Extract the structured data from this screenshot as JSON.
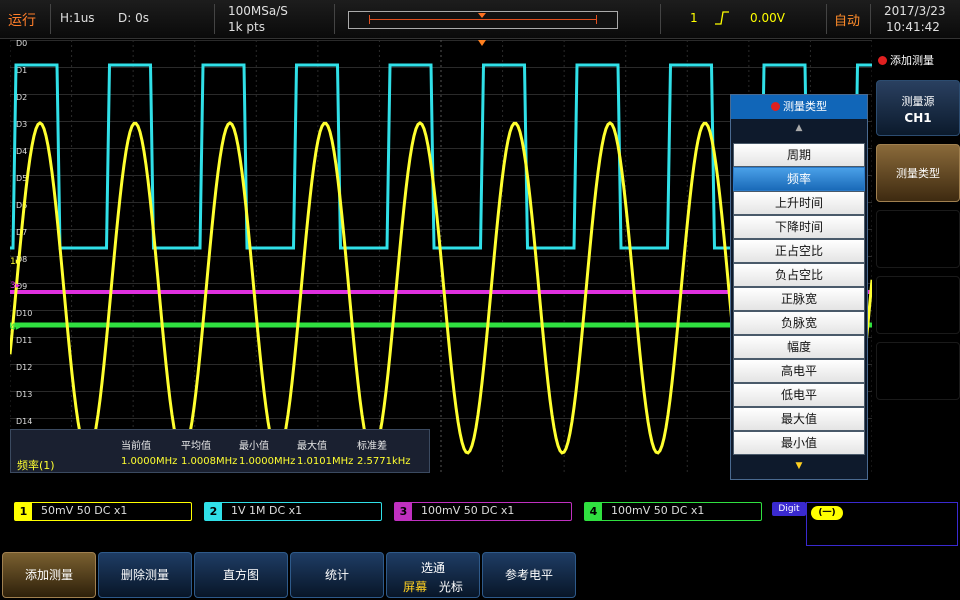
{
  "topbar": {
    "run_status": "运行",
    "horizontal": "H:1us",
    "delay": "D: 0s",
    "sample_rate": "100MSa/S",
    "points": "1k pts",
    "trigger_channel": "1",
    "trigger_level": "0.00V",
    "trigger_mode": "自动",
    "date": "2017/3/23",
    "time": "10:41:42"
  },
  "right_panel": {
    "title": "添加测量",
    "source_label": "测量源",
    "source_value": "CH1",
    "type_label": "测量类型"
  },
  "menu": {
    "title": "测量类型",
    "items": [
      "周期",
      "频率",
      "上升时间",
      "下降时间",
      "正占空比",
      "负占空比",
      "正脉宽",
      "负脉宽",
      "幅度",
      "高电平",
      "低电平",
      "最大值",
      "最小值"
    ],
    "selected_index": 1
  },
  "digital_labels": [
    "D0",
    "D1",
    "D2",
    "D3",
    "D4",
    "D5",
    "D6",
    "D7",
    "D8",
    "D9",
    "D10",
    "D11",
    "D12",
    "D13",
    "D14"
  ],
  "measurement": {
    "headers": [
      "当前值",
      "平均值",
      "最小值",
      "最大值",
      "标准差"
    ],
    "name": "频率(1)",
    "values": [
      "1.0000MHz",
      "1.0008MHz",
      "1.0000MHz",
      "1.0101MHz",
      "2.5771kHz"
    ]
  },
  "channels": [
    {
      "num": "1",
      "text": "50mV   50  DC          x1",
      "color": "#ffff00"
    },
    {
      "num": "2",
      "text": "1V        1M  DC          x1",
      "color": "#30e0e8"
    },
    {
      "num": "3",
      "text": "100mV  50  DC          x1",
      "color": "#c030c0"
    },
    {
      "num": "4",
      "text": "100mV  50  DC          x1",
      "color": "#30e040"
    }
  ],
  "digit": {
    "label": "Digit",
    "badge": "(一)"
  },
  "bottom_keys": [
    "添加测量",
    "删除测量",
    "直方图",
    "统计",
    "选通",
    "参考电平"
  ],
  "gate": {
    "label": "选通",
    "opt1": "屏幕",
    "opt2": "光标"
  },
  "colors": {
    "ch1": "#ffff00",
    "ch2": "#30e0e8",
    "ch3": "#e030e0",
    "ch4": "#30e040",
    "accent": "#ff8c2a"
  }
}
